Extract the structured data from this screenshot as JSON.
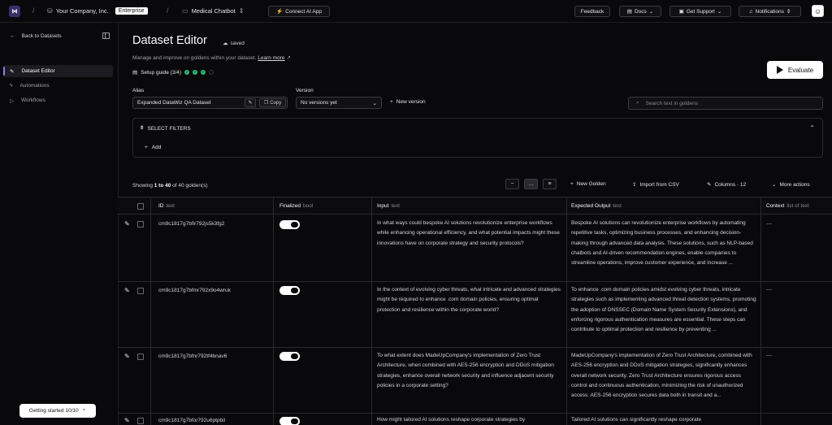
{
  "topbar": {
    "logo": "logo-icon",
    "company": "Your Company, Inc.",
    "plan_badge": "Enterprise",
    "project": "Medical Chatbot",
    "connect": "Connect AI App",
    "feedback": "Feedback",
    "docs": "Docs",
    "support": "Get Support",
    "notifications": "Notifications"
  },
  "sidebar": {
    "back": "Back to Datasets",
    "items": [
      {
        "label": "Dataset Editor",
        "icon": "pen-icon",
        "active": true
      },
      {
        "label": "Automations",
        "icon": "bolt-icon",
        "active": false
      },
      {
        "label": "Workflows",
        "icon": "play-square-icon",
        "active": false
      }
    ],
    "getting_started": "Getting started 10/10"
  },
  "header": {
    "title": "Dataset Editor",
    "saved": "saved",
    "subtitle": "Manage and improve on goldens within your dataset.",
    "learn_more": "Learn more",
    "setup_guide": "Setup guide (3/4)",
    "setup_steps_done": 3,
    "setup_steps_total": 4,
    "evaluate": "Evaluate"
  },
  "alias": {
    "label": "Alias",
    "value": "Expanded DataWiz QA Dataset",
    "copy": "Copy"
  },
  "version": {
    "label": "Version",
    "value": "No versions yet",
    "new_version": "New version"
  },
  "search": {
    "placeholder": "Search text in goldens"
  },
  "filters": {
    "title": "SELECT FILTERS",
    "add": "Add"
  },
  "toolbar": {
    "showing_prefix": "Showing ",
    "showing_range": "1 to 40",
    "showing_suffix": " of 40 golden(s)",
    "new_golden": "New Golden",
    "import_csv": "Import from CSV",
    "columns": "Columns · 12",
    "more_actions": "More actions"
  },
  "table": {
    "columns": [
      {
        "name": "ID",
        "type": "text"
      },
      {
        "name": "Finalized",
        "type": "bool"
      },
      {
        "name": "Input",
        "type": "text"
      },
      {
        "name": "Expected Output",
        "type": "text"
      },
      {
        "name": "Context",
        "type": "list of text"
      }
    ],
    "rows": [
      {
        "id": "cm9c1817g7bfir792js5k3fg2",
        "finalized": true,
        "input": "In what ways could bespoke AI solutions revolutionize enterprise workflows while enhancing operational efficiency, and what potential impacts might these innovations have on corporate strategy and security protocols?",
        "expected_output": "Bespoke AI solutions can revolutionize enterprise workflows by automating repetitive tasks, optimizing business processes, and enhancing decision-making through advanced data analysis. These solutions, such as NLP-based chatbots and AI-driven recommendation engines, enable companies to streamline operations, improve customer experience, and increase ...",
        "context": "—"
      },
      {
        "id": "cm9c1817g7bfmr792x9o4wruk",
        "finalized": true,
        "input": "In the context of evolving cyber threats, what intricate and advanced strategies might be required to enhance .com domain policies, ensuring optimal protection and resilience within the corporate world?",
        "expected_output": "To enhance .com domain policies amidst evolving cyber threats, intricate strategies such as implementing advanced threat detection systems, promoting the adoption of DNSSEC (Domain Name System Security Extensions), and enforcing rigorous authentication measures are essential. These steps can contribute to optimal protection and resilience by preventing ...",
        "context": "—"
      },
      {
        "id": "cm9c1817g7bfnr792tf4bnav6",
        "finalized": true,
        "input": "To what extent does MadeUpCompany's implementation of Zero Trust Architecture, when combined with AES-256 encryption and DDoS mitigation strategies, enhance overall network security and influence adjacent security policies in a corporate setting?",
        "expected_output": "MadeUpCompany's implementation of Zero Trust Architecture, combined with AES-256 encryption and DDoS mitigation strategies, significantly enhances overall network security. Zero Trust Architecture ensures rigorous access control and continuous authentication, minimizing the risk of unauthorized access. AES-256 encryption secures data both in transit and a...",
        "context": "—"
      },
      {
        "id": "cm9c1817g7bfor792u6ptpbil",
        "finalized": true,
        "input": "How might tailored AI solutions reshape corporate strategies by",
        "expected_output": "Tailored AI solutions can significantly reshape corporate",
        "context": ""
      }
    ]
  }
}
